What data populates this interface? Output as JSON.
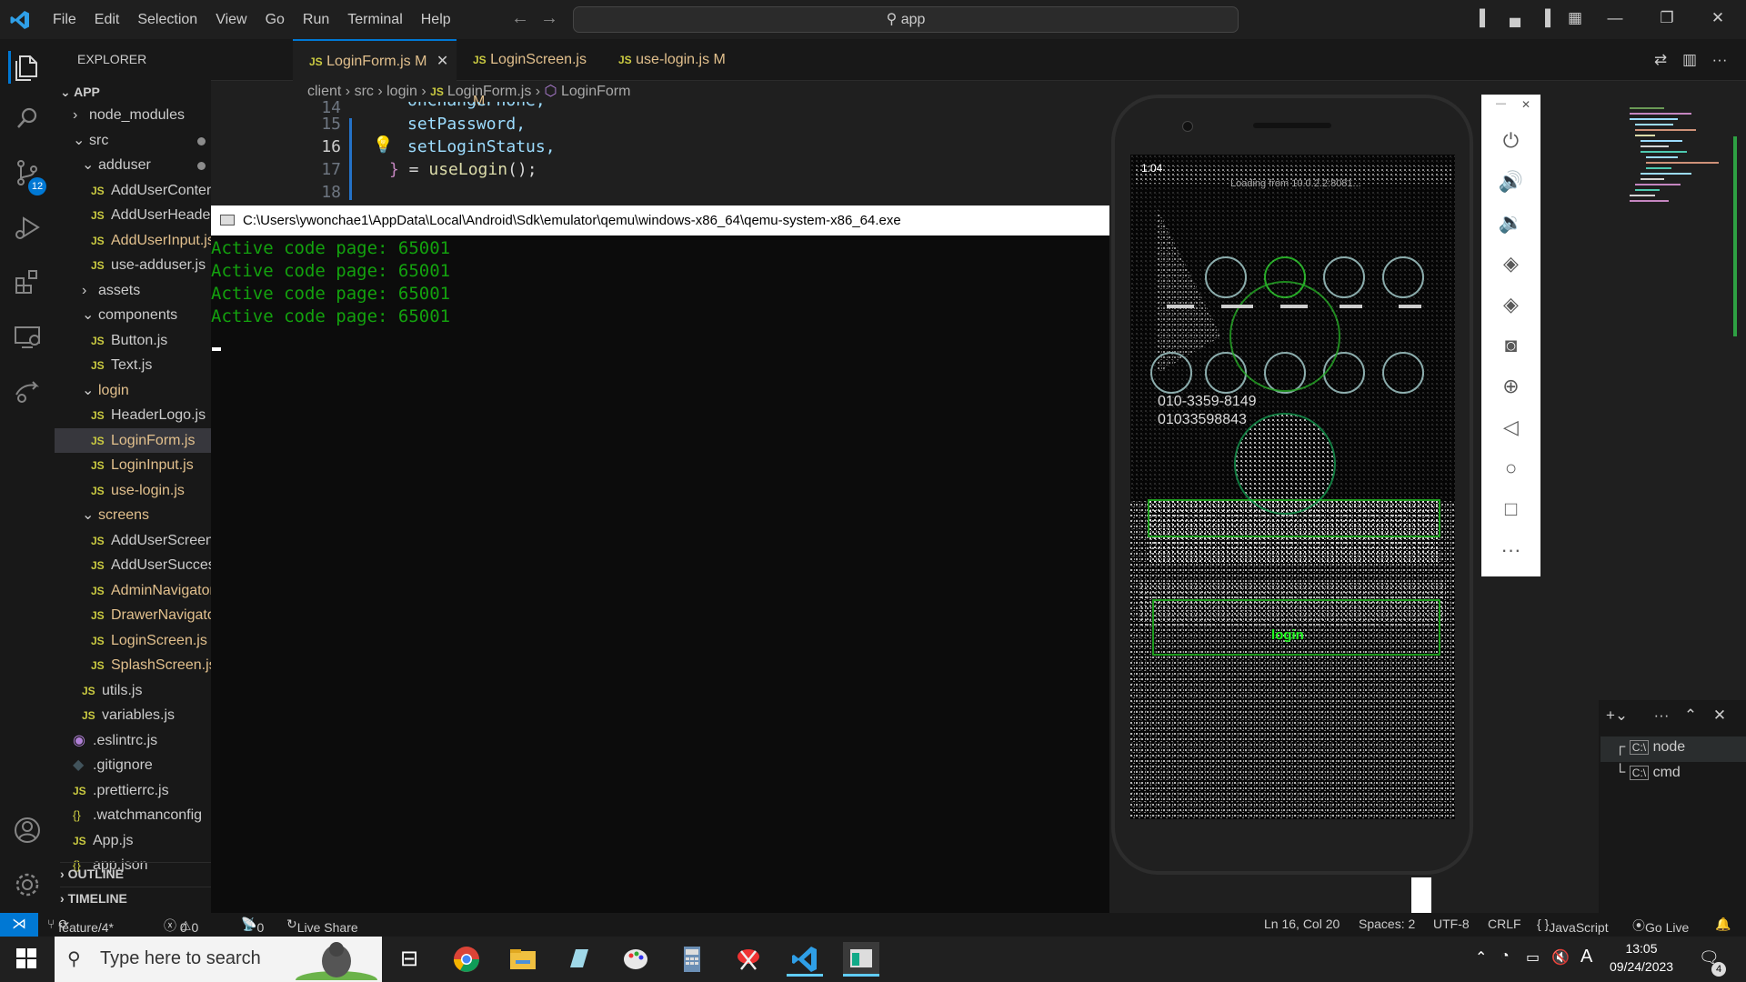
{
  "menu": [
    "File",
    "Edit",
    "Selection",
    "View",
    "Go",
    "Run",
    "Terminal",
    "Help"
  ],
  "command_center": {
    "text": "app"
  },
  "activity": {
    "source_control_badge": "12"
  },
  "explorer": {
    "title": "EXPLORER",
    "root": "APP",
    "tree": [
      {
        "label": "node_modules",
        "indent": 1,
        "type": "folder",
        "open": false
      },
      {
        "label": "src",
        "indent": 1,
        "type": "folder",
        "open": true,
        "dot": true
      },
      {
        "label": "adduser",
        "indent": 2,
        "type": "folder",
        "open": true,
        "dot": true
      },
      {
        "label": "AddUserContent.js",
        "indent": 3,
        "type": "js"
      },
      {
        "label": "AddUserHeader.js",
        "indent": 3,
        "type": "js"
      },
      {
        "label": "AddUserInput.js",
        "indent": 3,
        "type": "js",
        "mod": true
      },
      {
        "label": "use-adduser.js",
        "indent": 3,
        "type": "js"
      },
      {
        "label": "assets",
        "indent": 2,
        "type": "folder",
        "open": false
      },
      {
        "label": "components",
        "indent": 2,
        "type": "folder",
        "open": true
      },
      {
        "label": "Button.js",
        "indent": 3,
        "type": "js"
      },
      {
        "label": "Text.js",
        "indent": 3,
        "type": "js"
      },
      {
        "label": "login",
        "indent": 2,
        "type": "folder",
        "open": true,
        "mod": true
      },
      {
        "label": "HeaderLogo.js",
        "indent": 3,
        "type": "js"
      },
      {
        "label": "LoginForm.js",
        "indent": 3,
        "type": "js",
        "mod": true,
        "selected": true
      },
      {
        "label": "LoginInput.js",
        "indent": 3,
        "type": "js",
        "mod": true
      },
      {
        "label": "use-login.js",
        "indent": 3,
        "type": "js",
        "mod": true
      },
      {
        "label": "screens",
        "indent": 2,
        "type": "folder",
        "open": true,
        "mod": true
      },
      {
        "label": "AddUserScreen.js",
        "indent": 3,
        "type": "js"
      },
      {
        "label": "AddUserSuccess.js",
        "indent": 3,
        "type": "js"
      },
      {
        "label": "AdminNavigator.js",
        "indent": 3,
        "type": "js",
        "mod": true
      },
      {
        "label": "DrawerNavigator.js",
        "indent": 3,
        "type": "js",
        "mod": true
      },
      {
        "label": "LoginScreen.js",
        "indent": 3,
        "type": "js",
        "mod": true
      },
      {
        "label": "SplashScreen.js",
        "indent": 3,
        "type": "js",
        "mod": true
      },
      {
        "label": "utils.js",
        "indent": 2,
        "type": "js"
      },
      {
        "label": "variables.js",
        "indent": 2,
        "type": "js"
      },
      {
        "label": ".eslintrc.js",
        "indent": 1,
        "type": "eslint"
      },
      {
        "label": ".gitignore",
        "indent": 1,
        "type": "git"
      },
      {
        "label": ".prettierrc.js",
        "indent": 1,
        "type": "js"
      },
      {
        "label": ".watchmanconfig",
        "indent": 1,
        "type": "json"
      },
      {
        "label": "App.js",
        "indent": 1,
        "type": "js"
      },
      {
        "label": "app.json",
        "indent": 1,
        "type": "json"
      }
    ],
    "outline": "OUTLINE",
    "timeline": "TIMELINE"
  },
  "tabs": [
    {
      "label": "LoginForm.js",
      "badge": "M",
      "active": true
    },
    {
      "label": "LoginScreen.js",
      "badge": "M"
    },
    {
      "label": "use-login.js",
      "badge": "M"
    }
  ],
  "breadcrumb": [
    "client",
    "src",
    "login",
    "LoginForm.js",
    "LoginForm"
  ],
  "code": [
    {
      "n": "14",
      "text": "onChangePhone,"
    },
    {
      "n": "15",
      "text": "setPassword,"
    },
    {
      "n": "16",
      "text": "setLoginStatus,"
    },
    {
      "n": "17",
      "text": "} = useLogin();"
    },
    {
      "n": "18",
      "text": ""
    }
  ],
  "console": {
    "title": "C:\\Users\\ywonchae1\\AppData\\Local\\Android\\Sdk\\emulator\\qemu\\windows-x86_64\\qemu-system-x86_64.exe",
    "lines": [
      "Active code page: 65001",
      "Active code page: 65001",
      "Active code page: 65001",
      "Active code page: 65001"
    ]
  },
  "phone": {
    "status_time": "1:04",
    "loading": "Loading from 10.0.2.2:8081...",
    "numbers": [
      "010-3359-8149",
      "01033598843"
    ],
    "green_text": "login"
  },
  "terminal": {
    "items": [
      "node",
      "cmd"
    ]
  },
  "status": {
    "branch": "feature/4*",
    "errors": "0",
    "warnings": "0",
    "ports": "0",
    "live_share": "Live Share",
    "position": "Ln 16, Col 20",
    "spaces": "Spaces: 2",
    "encoding": "UTF-8",
    "eol": "CRLF",
    "language": "JavaScript",
    "go_live": "Go Live"
  },
  "taskbar": {
    "search_placeholder": "Type here to search",
    "time": "13:05",
    "date": "09/24/2023",
    "notifications": "4"
  }
}
